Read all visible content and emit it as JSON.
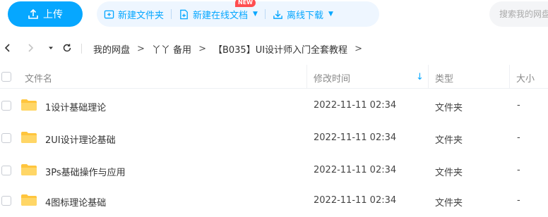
{
  "toolbar": {
    "upload_label": "上传",
    "new_folder_label": "新建文件夹",
    "new_online_doc_label": "新建在线文档",
    "new_badge": "NEW",
    "offline_download_label": "离线下载",
    "search_placeholder": "搜索我的网盘文件"
  },
  "breadcrumb": {
    "items": [
      "我的网盘",
      "丫丫 备用",
      "【B035】UI设计师入门全套教程"
    ],
    "separator": ">"
  },
  "table": {
    "headers": {
      "name": "文件名",
      "modified": "修改时间",
      "type": "类型",
      "size": "大小"
    },
    "rows": [
      {
        "name": "1设计基础理论",
        "modified": "2022-11-11 02:34",
        "type": "文件夹",
        "size": "-"
      },
      {
        "name": "2UI设计理论基础",
        "modified": "2022-11-11 02:34",
        "type": "文件夹",
        "size": "-"
      },
      {
        "name": "3Ps基础操作与应用",
        "modified": "2022-11-11 02:34",
        "type": "文件夹",
        "size": "-"
      },
      {
        "name": "4图标理论基础",
        "modified": "2022-11-11 02:34",
        "type": "文件夹",
        "size": "-"
      }
    ]
  },
  "colors": {
    "accent": "#06a7ff",
    "folder": "#ffc53d",
    "badge": "#ff4d4f"
  }
}
